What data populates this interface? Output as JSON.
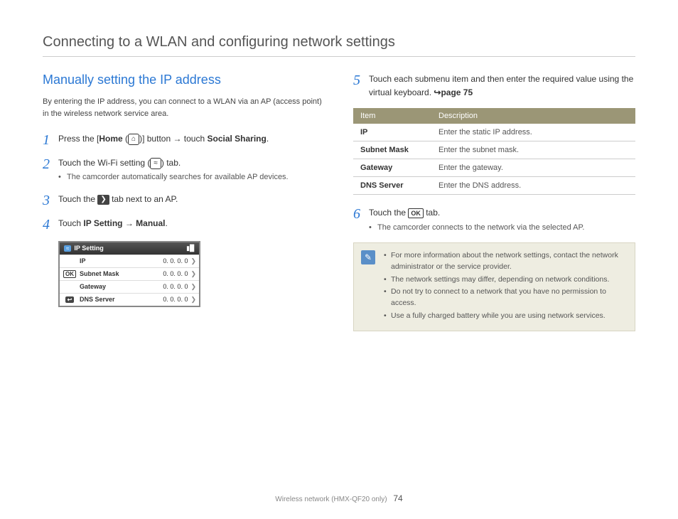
{
  "page_title": "Connecting to a WLAN and configuring network settings",
  "section_title": "Manually setting the IP address",
  "intro": "By entering the IP address, you can connect to a WLAN via an AP (access point) in the wireless network service area.",
  "steps": {
    "s1_pre": "Press the [",
    "s1_home": "Home",
    "s1_mid": " (",
    "s1_post": ")] button → touch ",
    "s1_social": "Social Sharing",
    "s2_a": "Touch the Wi-Fi setting (",
    "s2_b": ") tab.",
    "s2_sub": "The camcorder automatically searches for available AP devices.",
    "s3_a": "Touch the ",
    "s3_b": " tab next to an AP.",
    "s4_a": "Touch ",
    "s4_b": "IP Setting",
    "s4_c": " → ",
    "s4_d": "Manual",
    "s5": "Touch each submenu item and then enter the required value using the virtual keyboard. ",
    "s5_ref": "↪page 75",
    "s6_a": "Touch the ",
    "s6_b": " tab.",
    "s6_sub": "The camcorder connects to the network via the selected AP."
  },
  "ipbox": {
    "title": "IP Setting",
    "rows": [
      {
        "left": "",
        "label": "IP",
        "val": "0. 0. 0. 0"
      },
      {
        "left": "OK",
        "label": "Subnet Mask",
        "val": "0. 0. 0. 0"
      },
      {
        "left": "",
        "label": "Gateway",
        "val": "0. 0. 0. 0"
      },
      {
        "left": "back",
        "label": "DNS Server",
        "val": "0. 0. 0. 0"
      }
    ]
  },
  "table": {
    "h1": "Item",
    "h2": "Description",
    "rows": [
      {
        "item": "IP",
        "desc": "Enter the static IP address."
      },
      {
        "item": "Subnet Mask",
        "desc": "Enter the subnet mask."
      },
      {
        "item": "Gateway",
        "desc": "Enter the gateway."
      },
      {
        "item": "DNS Server",
        "desc": "Enter the DNS address."
      }
    ]
  },
  "notes": [
    "For more information about the network settings, contact the network administrator or the service provider.",
    "The network settings may differ, depending on network conditions.",
    "Do not try to connect to a network that you have no permission to access.",
    "Use a fully charged battery while you are using network services."
  ],
  "footer": {
    "text": "Wireless network (HMX-QF20 only)",
    "page": "74"
  },
  "icons": {
    "home": "⌂",
    "wifi": "≈",
    "arrow": "❯",
    "ok": "OK",
    "back": "↩",
    "batt": "▮▉",
    "pencil": "✎"
  }
}
